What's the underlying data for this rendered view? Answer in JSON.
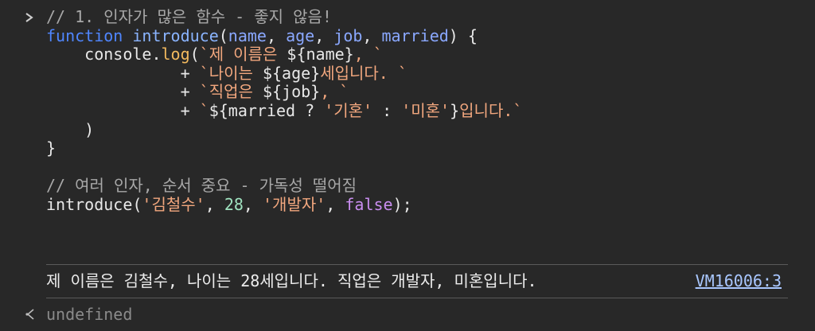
{
  "console": {
    "input_prompt_icon": "chevron-right-icon",
    "code_lines": [
      [
        {
          "t": "// 1. 인자가 많은 함수 - 좋지 않음!",
          "c": "cmt"
        }
      ],
      [
        {
          "t": "function",
          "c": "kw"
        },
        {
          "t": " ",
          "c": "plain"
        },
        {
          "t": "introduce",
          "c": "fn"
        },
        {
          "t": "(",
          "c": "plain"
        },
        {
          "t": "name",
          "c": "param"
        },
        {
          "t": ", ",
          "c": "plain"
        },
        {
          "t": "age",
          "c": "param"
        },
        {
          "t": ", ",
          "c": "plain"
        },
        {
          "t": "job",
          "c": "param"
        },
        {
          "t": ", ",
          "c": "plain"
        },
        {
          "t": "married",
          "c": "param"
        },
        {
          "t": ") {",
          "c": "plain"
        }
      ],
      [
        {
          "t": "    console.",
          "c": "plain"
        },
        {
          "t": "log",
          "c": "meth"
        },
        {
          "t": "(",
          "c": "plain"
        },
        {
          "t": "`제 이름은 ",
          "c": "str"
        },
        {
          "t": "${name}",
          "c": "plain"
        },
        {
          "t": ", `",
          "c": "str"
        }
      ],
      [
        {
          "t": "              + ",
          "c": "plain"
        },
        {
          "t": "`나이는 ",
          "c": "str"
        },
        {
          "t": "${age}",
          "c": "plain"
        },
        {
          "t": "세입니다. `",
          "c": "str"
        }
      ],
      [
        {
          "t": "              + ",
          "c": "plain"
        },
        {
          "t": "`직업은 ",
          "c": "str"
        },
        {
          "t": "${job}",
          "c": "plain"
        },
        {
          "t": ", `",
          "c": "str"
        }
      ],
      [
        {
          "t": "              + ",
          "c": "plain"
        },
        {
          "t": "`",
          "c": "str"
        },
        {
          "t": "${married ? ",
          "c": "plain"
        },
        {
          "t": "'기혼'",
          "c": "str"
        },
        {
          "t": " : ",
          "c": "plain"
        },
        {
          "t": "'미혼'",
          "c": "str"
        },
        {
          "t": "}",
          "c": "plain"
        },
        {
          "t": "입니다.`",
          "c": "str"
        }
      ],
      [
        {
          "t": "    )",
          "c": "plain"
        }
      ],
      [
        {
          "t": "}",
          "c": "plain"
        }
      ],
      [
        {
          "t": "",
          "c": "plain"
        }
      ],
      [
        {
          "t": "// 여러 인자, 순서 중요 - 가독성 떨어짐",
          "c": "cmt"
        }
      ],
      [
        {
          "t": "introduce",
          "c": "plain"
        },
        {
          "t": "(",
          "c": "plain"
        },
        {
          "t": "'김철수'",
          "c": "str"
        },
        {
          "t": ", ",
          "c": "plain"
        },
        {
          "t": "28",
          "c": "num"
        },
        {
          "t": ", ",
          "c": "plain"
        },
        {
          "t": "'개발자'",
          "c": "str"
        },
        {
          "t": ", ",
          "c": "plain"
        },
        {
          "t": "false",
          "c": "kwv"
        },
        {
          "t": ");",
          "c": "plain"
        }
      ]
    ],
    "log_message": "제 이름은 김철수, 나이는 28세입니다. 직업은 개발자, 미혼입니다.",
    "log_source": "VM16006:3",
    "result_icon": "return-arrow-icon",
    "result_value": "undefined"
  }
}
